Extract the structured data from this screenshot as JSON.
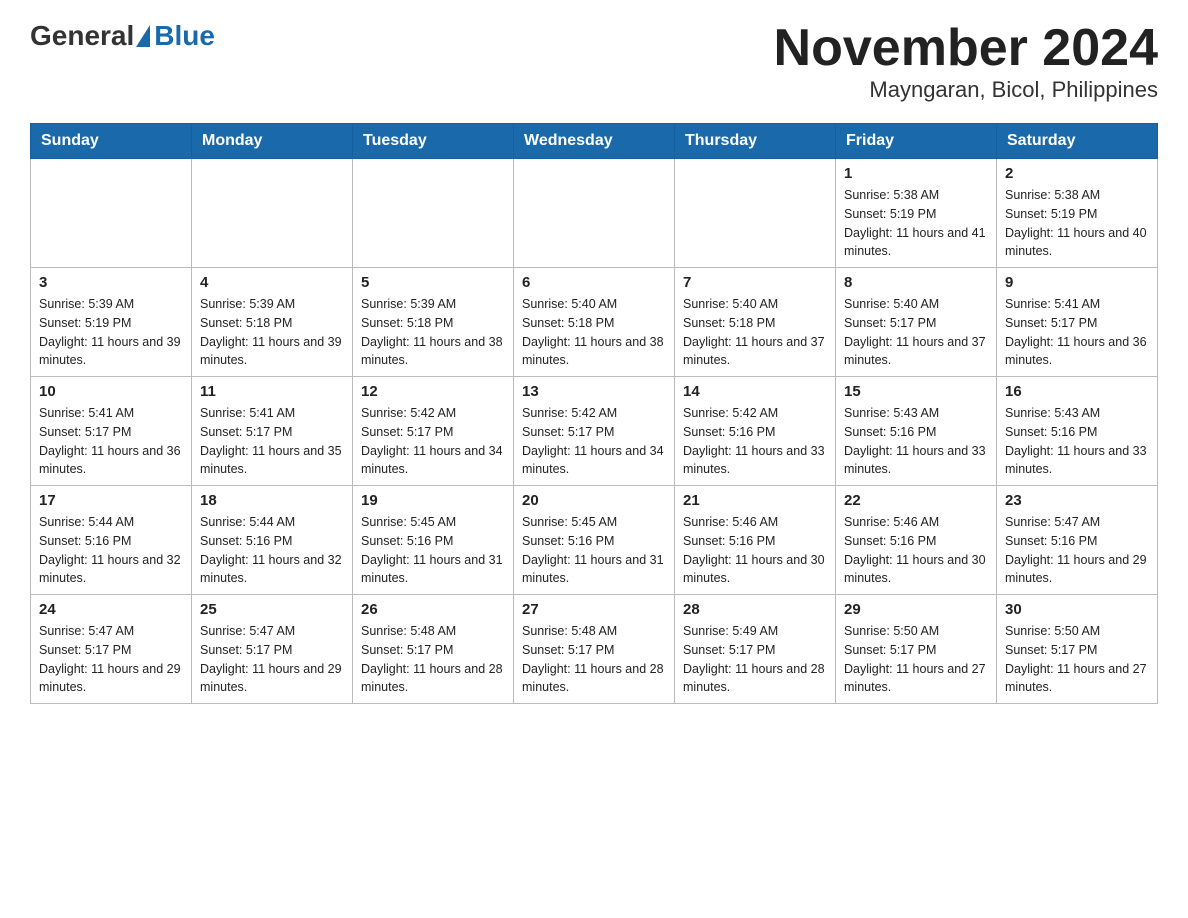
{
  "header": {
    "logo_general": "General",
    "logo_blue": "Blue",
    "title": "November 2024",
    "subtitle": "Mayngaran, Bicol, Philippines"
  },
  "weekdays": [
    "Sunday",
    "Monday",
    "Tuesday",
    "Wednesday",
    "Thursday",
    "Friday",
    "Saturday"
  ],
  "rows": [
    [
      {
        "day": "",
        "sunrise": "",
        "sunset": "",
        "daylight": ""
      },
      {
        "day": "",
        "sunrise": "",
        "sunset": "",
        "daylight": ""
      },
      {
        "day": "",
        "sunrise": "",
        "sunset": "",
        "daylight": ""
      },
      {
        "day": "",
        "sunrise": "",
        "sunset": "",
        "daylight": ""
      },
      {
        "day": "",
        "sunrise": "",
        "sunset": "",
        "daylight": ""
      },
      {
        "day": "1",
        "sunrise": "Sunrise: 5:38 AM",
        "sunset": "Sunset: 5:19 PM",
        "daylight": "Daylight: 11 hours and 41 minutes."
      },
      {
        "day": "2",
        "sunrise": "Sunrise: 5:38 AM",
        "sunset": "Sunset: 5:19 PM",
        "daylight": "Daylight: 11 hours and 40 minutes."
      }
    ],
    [
      {
        "day": "3",
        "sunrise": "Sunrise: 5:39 AM",
        "sunset": "Sunset: 5:19 PM",
        "daylight": "Daylight: 11 hours and 39 minutes."
      },
      {
        "day": "4",
        "sunrise": "Sunrise: 5:39 AM",
        "sunset": "Sunset: 5:18 PM",
        "daylight": "Daylight: 11 hours and 39 minutes."
      },
      {
        "day": "5",
        "sunrise": "Sunrise: 5:39 AM",
        "sunset": "Sunset: 5:18 PM",
        "daylight": "Daylight: 11 hours and 38 minutes."
      },
      {
        "day": "6",
        "sunrise": "Sunrise: 5:40 AM",
        "sunset": "Sunset: 5:18 PM",
        "daylight": "Daylight: 11 hours and 38 minutes."
      },
      {
        "day": "7",
        "sunrise": "Sunrise: 5:40 AM",
        "sunset": "Sunset: 5:18 PM",
        "daylight": "Daylight: 11 hours and 37 minutes."
      },
      {
        "day": "8",
        "sunrise": "Sunrise: 5:40 AM",
        "sunset": "Sunset: 5:17 PM",
        "daylight": "Daylight: 11 hours and 37 minutes."
      },
      {
        "day": "9",
        "sunrise": "Sunrise: 5:41 AM",
        "sunset": "Sunset: 5:17 PM",
        "daylight": "Daylight: 11 hours and 36 minutes."
      }
    ],
    [
      {
        "day": "10",
        "sunrise": "Sunrise: 5:41 AM",
        "sunset": "Sunset: 5:17 PM",
        "daylight": "Daylight: 11 hours and 36 minutes."
      },
      {
        "day": "11",
        "sunrise": "Sunrise: 5:41 AM",
        "sunset": "Sunset: 5:17 PM",
        "daylight": "Daylight: 11 hours and 35 minutes."
      },
      {
        "day": "12",
        "sunrise": "Sunrise: 5:42 AM",
        "sunset": "Sunset: 5:17 PM",
        "daylight": "Daylight: 11 hours and 34 minutes."
      },
      {
        "day": "13",
        "sunrise": "Sunrise: 5:42 AM",
        "sunset": "Sunset: 5:17 PM",
        "daylight": "Daylight: 11 hours and 34 minutes."
      },
      {
        "day": "14",
        "sunrise": "Sunrise: 5:42 AM",
        "sunset": "Sunset: 5:16 PM",
        "daylight": "Daylight: 11 hours and 33 minutes."
      },
      {
        "day": "15",
        "sunrise": "Sunrise: 5:43 AM",
        "sunset": "Sunset: 5:16 PM",
        "daylight": "Daylight: 11 hours and 33 minutes."
      },
      {
        "day": "16",
        "sunrise": "Sunrise: 5:43 AM",
        "sunset": "Sunset: 5:16 PM",
        "daylight": "Daylight: 11 hours and 33 minutes."
      }
    ],
    [
      {
        "day": "17",
        "sunrise": "Sunrise: 5:44 AM",
        "sunset": "Sunset: 5:16 PM",
        "daylight": "Daylight: 11 hours and 32 minutes."
      },
      {
        "day": "18",
        "sunrise": "Sunrise: 5:44 AM",
        "sunset": "Sunset: 5:16 PM",
        "daylight": "Daylight: 11 hours and 32 minutes."
      },
      {
        "day": "19",
        "sunrise": "Sunrise: 5:45 AM",
        "sunset": "Sunset: 5:16 PM",
        "daylight": "Daylight: 11 hours and 31 minutes."
      },
      {
        "day": "20",
        "sunrise": "Sunrise: 5:45 AM",
        "sunset": "Sunset: 5:16 PM",
        "daylight": "Daylight: 11 hours and 31 minutes."
      },
      {
        "day": "21",
        "sunrise": "Sunrise: 5:46 AM",
        "sunset": "Sunset: 5:16 PM",
        "daylight": "Daylight: 11 hours and 30 minutes."
      },
      {
        "day": "22",
        "sunrise": "Sunrise: 5:46 AM",
        "sunset": "Sunset: 5:16 PM",
        "daylight": "Daylight: 11 hours and 30 minutes."
      },
      {
        "day": "23",
        "sunrise": "Sunrise: 5:47 AM",
        "sunset": "Sunset: 5:16 PM",
        "daylight": "Daylight: 11 hours and 29 minutes."
      }
    ],
    [
      {
        "day": "24",
        "sunrise": "Sunrise: 5:47 AM",
        "sunset": "Sunset: 5:17 PM",
        "daylight": "Daylight: 11 hours and 29 minutes."
      },
      {
        "day": "25",
        "sunrise": "Sunrise: 5:47 AM",
        "sunset": "Sunset: 5:17 PM",
        "daylight": "Daylight: 11 hours and 29 minutes."
      },
      {
        "day": "26",
        "sunrise": "Sunrise: 5:48 AM",
        "sunset": "Sunset: 5:17 PM",
        "daylight": "Daylight: 11 hours and 28 minutes."
      },
      {
        "day": "27",
        "sunrise": "Sunrise: 5:48 AM",
        "sunset": "Sunset: 5:17 PM",
        "daylight": "Daylight: 11 hours and 28 minutes."
      },
      {
        "day": "28",
        "sunrise": "Sunrise: 5:49 AM",
        "sunset": "Sunset: 5:17 PM",
        "daylight": "Daylight: 11 hours and 28 minutes."
      },
      {
        "day": "29",
        "sunrise": "Sunrise: 5:50 AM",
        "sunset": "Sunset: 5:17 PM",
        "daylight": "Daylight: 11 hours and 27 minutes."
      },
      {
        "day": "30",
        "sunrise": "Sunrise: 5:50 AM",
        "sunset": "Sunset: 5:17 PM",
        "daylight": "Daylight: 11 hours and 27 minutes."
      }
    ]
  ]
}
